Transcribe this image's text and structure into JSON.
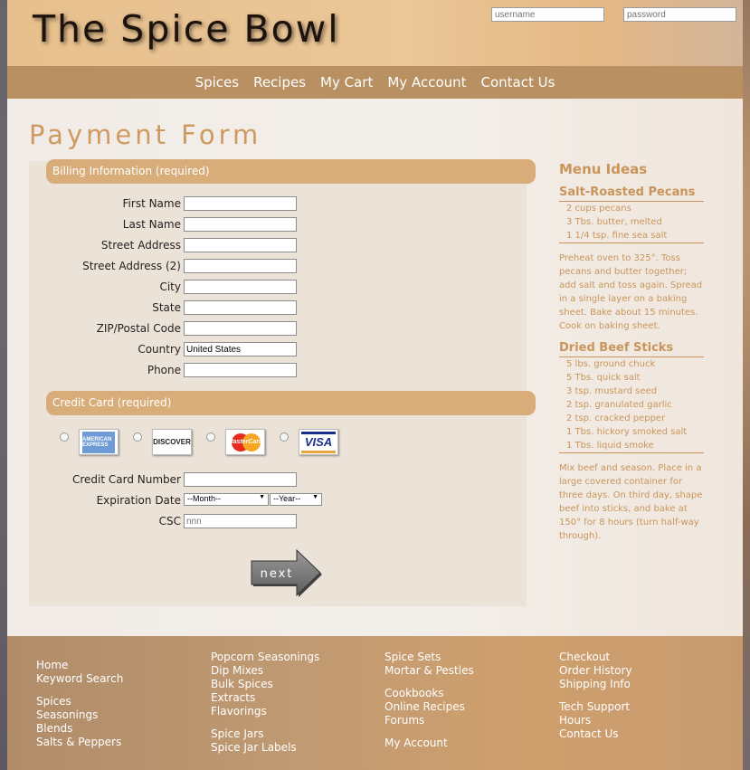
{
  "header": {
    "site_title": "The Spice Bowl",
    "username_placeholder": "username",
    "password_placeholder": "password"
  },
  "nav": [
    "Spices",
    "Recipes",
    "My Cart",
    "My Account",
    "Contact Us"
  ],
  "page_title": "Payment Form",
  "billing": {
    "section_title": "Billing Information (required)",
    "fields": [
      {
        "label": "First Name",
        "value": ""
      },
      {
        "label": "Last Name",
        "value": ""
      },
      {
        "label": "Street Address",
        "value": ""
      },
      {
        "label": "Street Address (2)",
        "value": ""
      },
      {
        "label": "City",
        "value": ""
      },
      {
        "label": "State",
        "value": ""
      },
      {
        "label": "ZIP/Postal Code",
        "value": ""
      },
      {
        "label": "Country",
        "value": "United States"
      },
      {
        "label": "Phone",
        "value": ""
      }
    ]
  },
  "credit_card": {
    "section_title": "Credit Card (required)",
    "cards": [
      "AMERICAN EXPRESS",
      "DISCOVER",
      "MasterCard",
      "VISA"
    ],
    "number_label": "Credit Card Number",
    "expiration_label": "Expiration Date",
    "month_select": "--Month--",
    "year_select": "--Year--",
    "csc_label": "CSC",
    "csc_placeholder": "nnn"
  },
  "next_button": "next",
  "sidebar": {
    "title": "Menu Ideas",
    "recipes": [
      {
        "title": "Salt-Roasted Pecans",
        "ingredients": [
          "2 cups pecans",
          "3 Tbs. butter, melted",
          "1 1/4 tsp. fine sea salt"
        ],
        "instructions": "Preheat oven to 325°. Toss pecans and butter together; add salt and toss again. Spread in a single layer on a baking sheet. Bake about 15 minutes. Cook on baking sheet."
      },
      {
        "title": "Dried Beef Sticks",
        "ingredients": [
          "5 lbs. ground chuck",
          "5 Tbs. quick salt",
          "3 tsp. mustard seed",
          "2 tsp. granulated garlic",
          "2 tsp. cracked pepper",
          "1 Tbs. hickory smoked salt",
          "1 Tbs. liquid smoke"
        ],
        "instructions": "Mix beef and season. Place in a large covered container for three days. On third day, shape beef into sticks, and bake at 150° for 8 hours (turn half-way through)."
      }
    ]
  },
  "footer": {
    "col1": [
      [
        "Home",
        "Keyword Search"
      ],
      [
        "Spices",
        "Seasonings",
        "Blends",
        "Salts & Peppers"
      ]
    ],
    "col2": [
      [
        "Popcorn Seasonings",
        "Dip Mixes",
        "Bulk Spices",
        "Extracts",
        "Flavorings"
      ],
      [
        "Spice Jars",
        "Spice Jar Labels"
      ]
    ],
    "col3": [
      [
        "Spice Sets",
        "Mortar & Pestles"
      ],
      [
        "Cookbooks",
        "Online Recipes",
        "Forums"
      ],
      [
        "My Account"
      ]
    ],
    "col4": [
      [
        "Checkout",
        "Order History",
        "Shipping Info"
      ],
      [
        "Tech Support",
        "Hours",
        "Contact Us"
      ]
    ]
  }
}
